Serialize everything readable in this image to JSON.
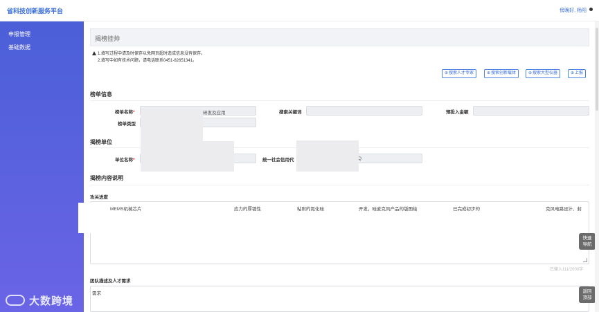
{
  "header": {
    "app_title": "省科技创新服务平台",
    "greeting": "傍晚好, 杨阳"
  },
  "sidebar": {
    "items": [
      {
        "label": "申报管理"
      },
      {
        "label": "基础数据"
      }
    ],
    "watermark": "大数跨境"
  },
  "main": {
    "page_title": "揭榜挂帅",
    "notices": [
      "1.填写过程中请及时保存以免网页超时造成信息没有保存。",
      "2.填写中如有技术问题，请电话联系0451-82651341。"
    ],
    "buttons": [
      {
        "label": "搜索人才专家"
      },
      {
        "label": "搜索创新载体"
      },
      {
        "label": "搜索大型仪器"
      },
      {
        "label": "上报"
      }
    ],
    "sections": {
      "list_info": "榜单信息",
      "unit": "揭榜单位",
      "content": "揭榜内容说明"
    },
    "fields": {
      "list_name_label": "榜单名称",
      "list_name_value": "研发及应用",
      "keywords_label": "搜索关键词",
      "keywords_value": "",
      "budget_label": "预投入金额",
      "budget_value": "",
      "list_type_label": "榜单类型",
      "list_type_value": "",
      "unit_name_label": "单位名称",
      "unit_name_value": "",
      "credit_code_label": "统一社会信用代",
      "credit_code_value": "Q"
    },
    "progress": {
      "label": "攻关进度",
      "segments": [
        "MEMS机械芯片",
        "应力的厚镀性",
        "粘附的氮化硅",
        "开发，硅麦克风产品的版图绘",
        "已完成初步的",
        "克风电路设计、封"
      ],
      "counter": "已输入111/2000字"
    },
    "team": {
      "label": "团队描述及人才需求",
      "value": "需求"
    },
    "float_buttons": {
      "quick_nav": [
        "快速",
        "导航"
      ],
      "back_top": [
        "返回",
        "顶部"
      ]
    }
  },
  "colors": {
    "accent": "#3a6fd8",
    "sidebar_top": "#4b5fd8",
    "sidebar_bottom": "#6a64e6"
  }
}
